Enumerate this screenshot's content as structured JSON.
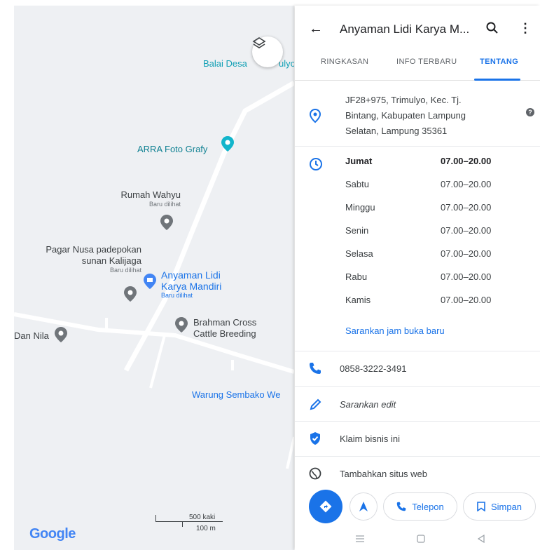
{
  "map": {
    "labels": {
      "balai_desa": "Balai Desa",
      "balai_desa_tail": "ulyo",
      "arra": "ARRA Foto Grafy",
      "rumah_wahyu": "Rumah Wahyu",
      "rumah_wahyu_sub": "Baru dilihat",
      "pagar_nusa_1": "Pagar Nusa padepokan",
      "pagar_nusa_2": "sunan Kalijaga",
      "pagar_nusa_sub": "Baru dilihat",
      "anyaman_1": "Anyaman Lidi",
      "anyaman_2": "Karya Mandiri",
      "anyaman_sub": "Baru dilihat",
      "brahman_1": "Brahman Cross",
      "brahman_2": "Cattle Breeding",
      "dan_nila": "Dan Nila",
      "warung": "Warung Sembako We"
    },
    "google_logo": "Google",
    "scale": {
      "imperial": "500 kaki",
      "metric": "100 m"
    },
    "colors": {
      "road": "#ffffff",
      "background": "#eef0f3",
      "pin_gray": "#70757a",
      "pin_teal": "#12b5cb",
      "pin_blue": "#4285f4",
      "blue_label": "#1a73e8"
    }
  },
  "panel": {
    "title": "Anyaman Lidi Karya M...",
    "tabs": [
      "RINGKASAN",
      "INFO TERBARU",
      "TENTANG"
    ],
    "address": "JF28+975, Trimulyo, Kec. Tj. Bintang, Kabupaten Lampung Selatan, Lampung 35361",
    "hours": [
      {
        "day": "Jumat",
        "time": "07.00–20.00"
      },
      {
        "day": "Sabtu",
        "time": "07.00–20.00"
      },
      {
        "day": "Minggu",
        "time": "07.00–20.00"
      },
      {
        "day": "Senin",
        "time": "07.00–20.00"
      },
      {
        "day": "Selasa",
        "time": "07.00–20.00"
      },
      {
        "day": "Rabu",
        "time": "07.00–20.00"
      },
      {
        "day": "Kamis",
        "time": "07.00–20.00"
      }
    ],
    "suggest_hours": "Sarankan jam buka baru",
    "phone": "0858-3222-3491",
    "suggest_edit": "Sarankan edit",
    "claim": "Klaim bisnis ini",
    "add_website": "Tambahkan situs web",
    "buttons": {
      "call": "Telepon",
      "save": "Simpan"
    },
    "accent": "#1a73e8"
  }
}
